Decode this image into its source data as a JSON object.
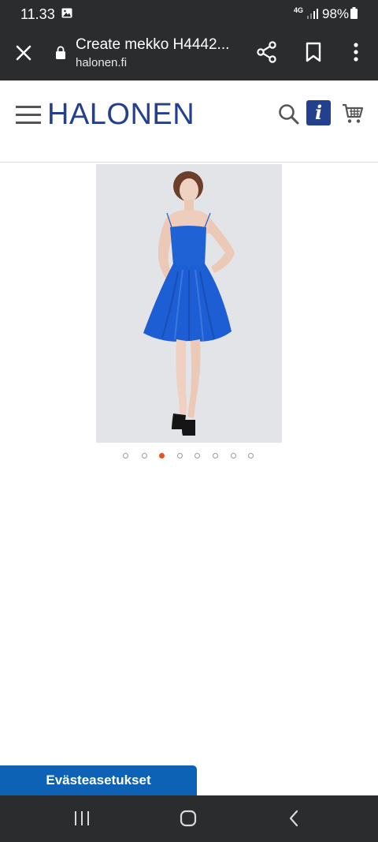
{
  "status_bar": {
    "time": "11.33",
    "network": "4G",
    "battery": "98%"
  },
  "browser": {
    "page_title": "Create mekko H4442...",
    "url": "halonen.fi"
  },
  "site": {
    "logo": "HALONEN",
    "info_icon_glyph": "i",
    "brand_color": "#23408e",
    "accent_color": "#e2551f"
  },
  "carousel": {
    "total_images": 8,
    "active_index": 3
  },
  "cookie": {
    "button_label": "Evästeasetukset"
  },
  "icons": [
    "image-icon",
    "signal-icon",
    "battery-icon",
    "close-icon",
    "lock-icon",
    "share-icon",
    "bookmark-icon",
    "more-vert-icon",
    "hamburger-menu-icon",
    "search-icon",
    "info-icon",
    "cart-icon",
    "recents-icon",
    "home-icon",
    "back-icon"
  ]
}
